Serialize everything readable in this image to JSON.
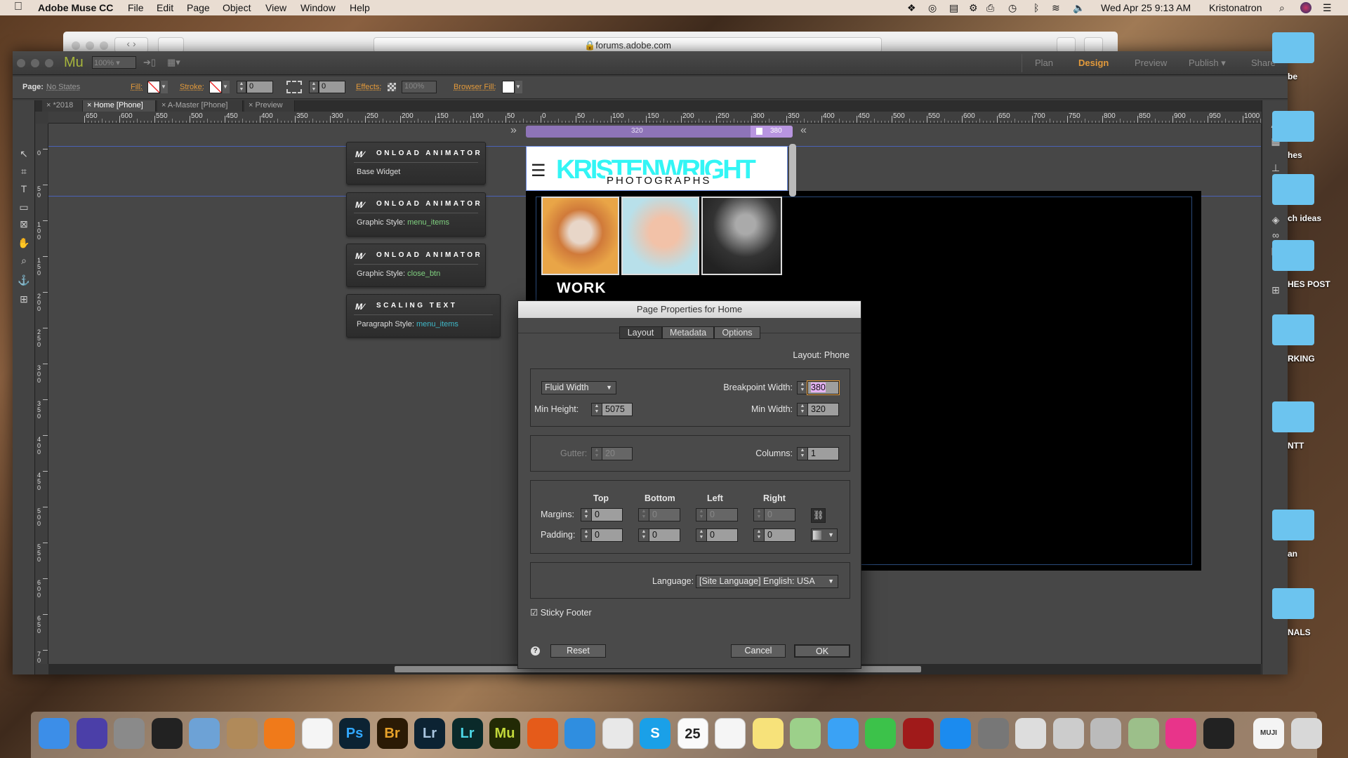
{
  "menubar": {
    "apple": "",
    "app": "Adobe Muse CC",
    "items": [
      "File",
      "Edit",
      "Page",
      "Object",
      "View",
      "Window",
      "Help"
    ],
    "clock": "Wed Apr 25  9:13 AM",
    "user": "Kristonatron",
    "status_icons": [
      "dropbox-icon",
      "creative-cloud-icon",
      "notification-icon",
      "gear-icon",
      "printer-icon",
      "time-machine-icon",
      "bluetooth-icon",
      "wifi-icon",
      "volume-icon"
    ]
  },
  "safari": {
    "url": "forums.adobe.com"
  },
  "muse": {
    "logo": "Mu",
    "zoom": "100%",
    "modes": {
      "plan": "Plan",
      "design": "Design",
      "preview": "Preview",
      "publish": "Publish",
      "share": "Share"
    },
    "control": {
      "page_label": "Page:",
      "page_value": "No States",
      "fill": "Fill:",
      "stroke": "Stroke:",
      "stroke_value": "0",
      "corner_value": "0",
      "effects": "Effects:",
      "effects_value": "100%",
      "browser_fill": "Browser Fill:"
    },
    "tabs": [
      {
        "label": "*2018",
        "active": false
      },
      {
        "label": "Home [Phone]",
        "active": true
      },
      {
        "label": "A-Master [Phone]",
        "active": false
      },
      {
        "label": "Preview",
        "active": false
      }
    ],
    "hruler": [
      "650",
      "600",
      "550",
      "500",
      "450",
      "400",
      "350",
      "300",
      "250",
      "200",
      "150",
      "100",
      "50",
      "0",
      "50",
      "100",
      "150",
      "200",
      "250",
      "300",
      "350",
      "400",
      "450",
      "500",
      "550",
      "600",
      "650",
      "700",
      "750",
      "800",
      "850",
      "900",
      "950",
      "1000"
    ],
    "vruler": [
      "0",
      "50",
      "100",
      "150",
      "200",
      "250",
      "300",
      "350",
      "400",
      "450",
      "500",
      "550",
      "600",
      "650",
      "700"
    ],
    "breakpoint": {
      "min": "320",
      "current": "380",
      "color": "#9b7cc4"
    },
    "widgets": [
      {
        "title": "ONLOAD ANIMATOR",
        "label": "Base Widget",
        "value": ""
      },
      {
        "title": "ONLOAD ANIMATOR",
        "label": "Graphic Style: ",
        "value": "menu_items"
      },
      {
        "title": "ONLOAD ANIMATOR",
        "label": "Graphic Style: ",
        "value": "close_btn"
      },
      {
        "title": "SCALING TEXT",
        "label": "Paragraph Style:  ",
        "value": "menu_items"
      }
    ],
    "page": {
      "logo_text": "KRISTENWRIGHT",
      "logo_sub": "PHOTOGRAPHS",
      "work": "WORK",
      "accent": "#33f5f5"
    }
  },
  "dialog": {
    "title": "Page Properties for Home",
    "tabs": [
      "Layout",
      "Metadata",
      "Options"
    ],
    "layout_label": "Layout: Phone",
    "width_mode": "Fluid Width",
    "breakpoint_label": "Breakpoint Width:",
    "breakpoint_value": "380",
    "min_height_label": "Min Height:",
    "min_height_value": "5075",
    "min_width_label": "Min Width:",
    "min_width_value": "320",
    "gutter_label": "Gutter:",
    "gutter_value": "20",
    "columns_label": "Columns:",
    "columns_value": "1",
    "headers": [
      "Top",
      "Bottom",
      "Left",
      "Right"
    ],
    "margins_label": "Margins:",
    "margins": [
      "0",
      "0",
      "0",
      "0"
    ],
    "padding_label": "Padding:",
    "padding": [
      "0",
      "0",
      "0",
      "0"
    ],
    "language_label": "Language:",
    "language_value": "[Site Language] English: USA",
    "sticky_footer": "Sticky Footer",
    "sticky_checked": true,
    "help": "?",
    "reset": "Reset",
    "cancel": "Cancel",
    "ok": "OK"
  },
  "desktop": {
    "folders": [
      "be",
      "hes",
      "ch ideas",
      "HES POST",
      "RKING",
      "NTT",
      "an",
      "NALS"
    ]
  },
  "dock": [
    {
      "name": "finder",
      "label": "",
      "bg": "#3c8ee8"
    },
    {
      "name": "siri",
      "label": "",
      "bg": "#4b3fa8"
    },
    {
      "name": "launchpad",
      "label": "",
      "bg": "#8a8a8a"
    },
    {
      "name": "activity-monitor",
      "label": "",
      "bg": "#222"
    },
    {
      "name": "preview",
      "label": "",
      "bg": "#6da2d6"
    },
    {
      "name": "contacts",
      "label": "",
      "bg": "#b08a5a"
    },
    {
      "name": "ibooks",
      "label": "",
      "bg": "#f07a1a"
    },
    {
      "name": "photos",
      "label": "",
      "bg": "#f5f5f5"
    },
    {
      "name": "photoshop",
      "label": "Ps",
      "bg": "#0c2333",
      "fg": "#31a8ff"
    },
    {
      "name": "bridge",
      "label": "Br",
      "bg": "#2b1a05",
      "fg": "#e8a22a"
    },
    {
      "name": "lightroom-classic",
      "label": "Lr",
      "bg": "#0c2333",
      "fg": "#a9c6e0"
    },
    {
      "name": "lightroom",
      "label": "Lr",
      "bg": "#0a2a2a",
      "fg": "#4dd9e8"
    },
    {
      "name": "muse",
      "label": "Mu",
      "bg": "#222a05",
      "fg": "#c2d83a"
    },
    {
      "name": "firefox",
      "label": "",
      "bg": "#e55b1a"
    },
    {
      "name": "safari",
      "label": "",
      "bg": "#2f8ee0"
    },
    {
      "name": "chrome",
      "label": "",
      "bg": "#e8e8e8"
    },
    {
      "name": "skype",
      "label": "S",
      "bg": "#1aa0e8",
      "fg": "#fff"
    },
    {
      "name": "calendar",
      "label": "25",
      "bg": "#fafafa",
      "fg": "#222"
    },
    {
      "name": "reminders",
      "label": "",
      "bg": "#f5f5f5"
    },
    {
      "name": "notes",
      "label": "",
      "bg": "#f7e27a"
    },
    {
      "name": "maps",
      "label": "",
      "bg": "#9cd08a"
    },
    {
      "name": "messages",
      "label": "",
      "bg": "#3aa2f5"
    },
    {
      "name": "facetime",
      "label": "",
      "bg": "#3cc24a"
    },
    {
      "name": "photo-booth",
      "label": "",
      "bg": "#a01a1a"
    },
    {
      "name": "app-store",
      "label": "",
      "bg": "#1b8bef"
    },
    {
      "name": "system-preferences",
      "label": "",
      "bg": "#777"
    },
    {
      "name": "dvd-player",
      "label": "",
      "bg": "#ddd"
    },
    {
      "name": "scissors-app",
      "label": "",
      "bg": "#ccc"
    },
    {
      "name": "preview-2",
      "label": "",
      "bg": "#bbb"
    },
    {
      "name": "image-capture",
      "label": "",
      "bg": "#9cbf8a"
    },
    {
      "name": "imac",
      "label": "",
      "bg": "#e8348a"
    },
    {
      "name": "scanner",
      "label": "",
      "bg": "#222"
    },
    {
      "name": "muji-notebook",
      "label": "MUJI",
      "bg": "#f4f4f4",
      "fg": "#333"
    },
    {
      "name": "trash",
      "label": "",
      "bg": "#d8d8d8"
    }
  ]
}
